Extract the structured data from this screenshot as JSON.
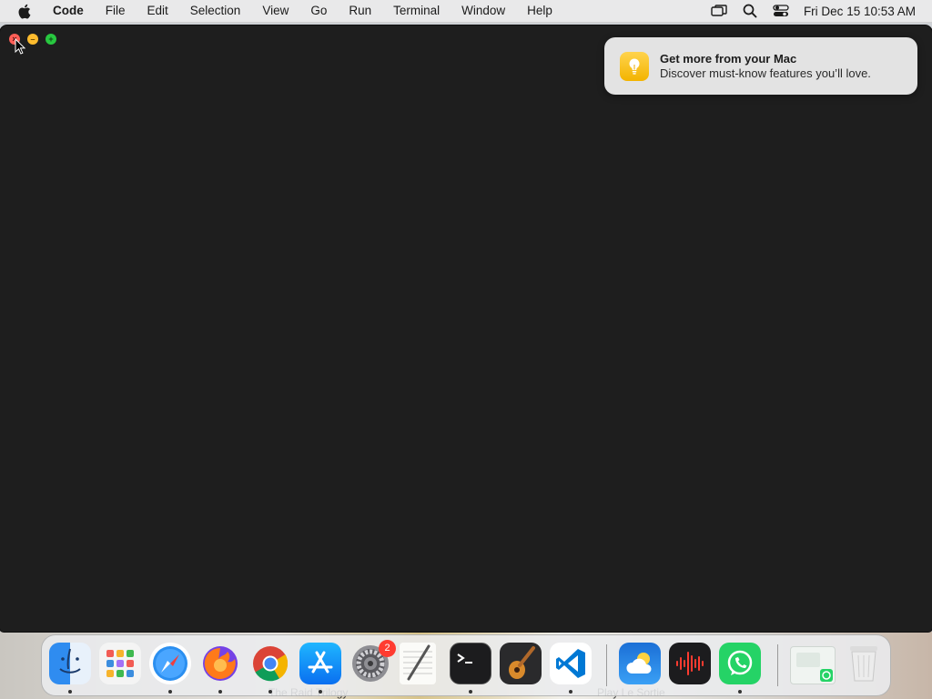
{
  "menubar": {
    "app_name": "Code",
    "items": [
      "File",
      "Edit",
      "Selection",
      "View",
      "Go",
      "Run",
      "Terminal",
      "Window",
      "Help"
    ],
    "clock": "Fri Dec 15  10:53 AM",
    "status_icons": [
      "screen-mirroring-icon",
      "spotlight-search-icon",
      "control-center-icon"
    ]
  },
  "window": {
    "title": "",
    "traffic_lights": [
      "close",
      "minimize",
      "zoom"
    ]
  },
  "notification": {
    "title": "Get more from your Mac",
    "body": "Discover must-know features you’ll love.",
    "icon": "lightbulb-icon"
  },
  "dock": {
    "apps": [
      {
        "name": "Finder",
        "running": true
      },
      {
        "name": "Launchpad",
        "running": false
      },
      {
        "name": "Safari",
        "running": true
      },
      {
        "name": "Firefox",
        "running": true
      },
      {
        "name": "Google Chrome",
        "running": true
      },
      {
        "name": "App Store",
        "running": true
      },
      {
        "name": "System Settings",
        "running": false,
        "badge": "2"
      },
      {
        "name": "TextEdit",
        "running": false
      },
      {
        "name": "Terminal",
        "running": true
      },
      {
        "name": "GarageBand",
        "running": false
      },
      {
        "name": "Visual Studio Code",
        "running": true
      },
      {
        "name": "Weather",
        "running": false
      },
      {
        "name": "Voice Memos",
        "running": false
      },
      {
        "name": "WhatsApp",
        "running": true
      },
      {
        "name": "WhatsApp Screenshot",
        "running": false
      },
      {
        "name": "Trash",
        "running": false
      }
    ]
  },
  "desktop": {
    "label_left": "The Raid Trilogy",
    "label_right": "Play Le Sortie"
  }
}
